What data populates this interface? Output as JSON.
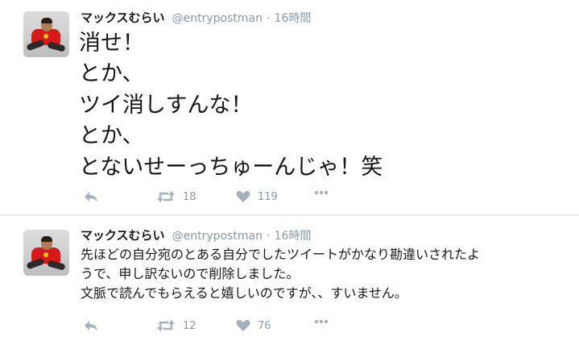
{
  "tweets": [
    {
      "name": "マックスむらい",
      "handle": "@entrypostman",
      "separator": "·",
      "time": "16時間",
      "lines": [
        "消せ！",
        "とか、",
        "ツイ消しすんな！",
        "とか、",
        "とないせーっちゅーんじゃ！笑"
      ],
      "retweets": "18",
      "likes": "119"
    },
    {
      "name": "マックスむらい",
      "handle": "@entrypostman",
      "separator": "·",
      "time": "16時間",
      "lines": [
        "先ほどの自分宛のとある自分でしたツイートがかなり勘違いされたよ",
        "うで、申し訳ないので削除しました。",
        "文脈で読んでもらえると嬉しいのですが、、すいません。"
      ],
      "retweets": "12",
      "likes": "76"
    }
  ],
  "icons": {
    "reply": "reply-icon",
    "retweet": "retweet-icon",
    "like": "heart-icon",
    "more": "more-dots-icon",
    "color": "#a3b1bd"
  }
}
